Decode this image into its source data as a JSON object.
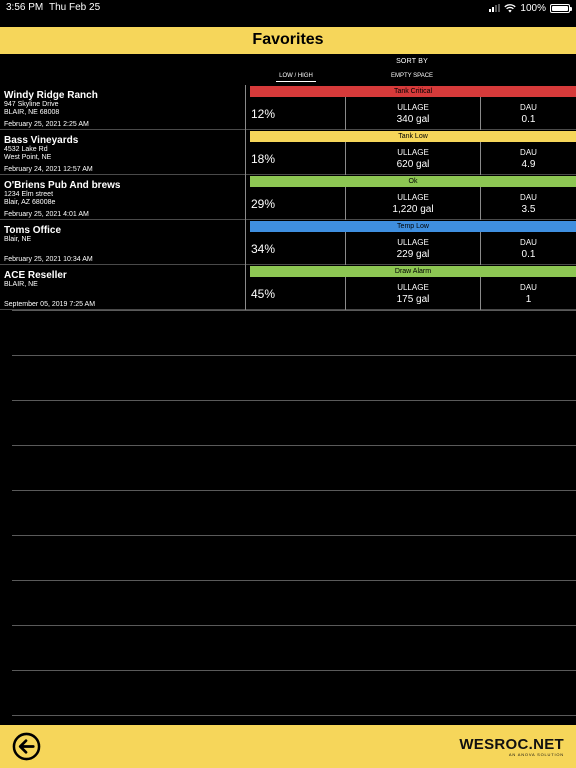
{
  "status_bar": {
    "time": "3:56 PM",
    "date": "Thu Feb 25",
    "battery": "100%",
    "icons": [
      "cellular-signal-icon",
      "wifi-icon",
      "battery-icon"
    ]
  },
  "header": {
    "title": "Favorites"
  },
  "sort": {
    "label": "SORT BY",
    "options": [
      "LOW / HIGH",
      "EMPTY SPACE"
    ],
    "selected": "LOW / HIGH"
  },
  "column_labels": {
    "ullage": "ULLAGE",
    "dau": "DAU"
  },
  "status_colors": {
    "Tank Critical": "#d63a3a",
    "Tank Low": "#f6d65a",
    "Ok": "#8dc653",
    "Temp Low": "#3f8fe0",
    "Draw Alarm": "#8dc653"
  },
  "rows": [
    {
      "name": "Windy Ridge Ranch",
      "address1": "947 Skyline Drive",
      "address2": "BLAIR, NE 68008",
      "date": "February 25, 2021 2:25 AM",
      "status": "Tank Critical",
      "percent": "12%",
      "ullage": "340 gal",
      "dau": "0.1"
    },
    {
      "name": "Bass Vineyards",
      "address1": "4532 Lake Rd",
      "address2": "West Point, NE",
      "date": "February 24, 2021 12:57 AM",
      "status": "Tank Low",
      "percent": "18%",
      "ullage": "620 gal",
      "dau": "4.9"
    },
    {
      "name": "O'Briens Pub And brews",
      "address1": "1234 Elm street",
      "address2": "Blair, AZ 68008e",
      "date": "February 25, 2021 4:01 AM",
      "status": "Ok",
      "percent": "29%",
      "ullage": "1,220 gal",
      "dau": "3.5"
    },
    {
      "name": "Toms Office",
      "address1": "Blair, NE",
      "address2": "",
      "date": "February 25, 2021 10:34 AM",
      "status": "Temp Low",
      "percent": "34%",
      "ullage": "229 gal",
      "dau": "0.1"
    },
    {
      "name": "ACE Reseller",
      "address1": "BLAIR, NE",
      "address2": "",
      "date": "September 05, 2019 7:25 AM",
      "status": "Draw Alarm",
      "percent": "45%",
      "ullage": "175 gal",
      "dau": "1"
    }
  ],
  "footer": {
    "back_icon": "back-arrow-icon",
    "brand_name": "WESROC.NET",
    "brand_sub": "AN ANOVA SOLUTION"
  }
}
